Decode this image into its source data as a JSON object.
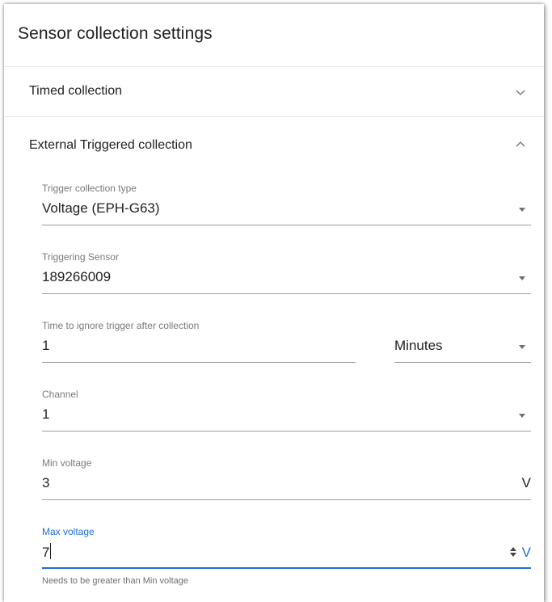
{
  "card": {
    "title": "Sensor collection settings"
  },
  "panels": {
    "timed": {
      "label": "Timed collection",
      "expanded": false
    },
    "external": {
      "label": "External Triggered collection",
      "expanded": true
    }
  },
  "fields": {
    "trigger_type": {
      "label": "Trigger collection type",
      "value": "Voltage (EPH-G63)"
    },
    "triggering_sensor": {
      "label": "Triggering Sensor",
      "value": "189266009"
    },
    "ignore_time": {
      "label": "Time to ignore trigger after collection",
      "value": "1",
      "unit": "Minutes"
    },
    "channel": {
      "label": "Channel",
      "value": "1"
    },
    "min_voltage": {
      "label": "Min voltage",
      "value": "3",
      "suffix": "V"
    },
    "max_voltage": {
      "label": "Max voltage",
      "value": "7",
      "suffix": "V",
      "hint": "Needs to be greater than Min voltage"
    }
  },
  "colors": {
    "accent": "#1e6fd9",
    "text": "#212121",
    "secondary_text": "#7a7a7a",
    "divider": "#e6e6e6"
  },
  "icons": {
    "collapsed": "chevron-down-icon",
    "expanded": "chevron-up-icon",
    "dropdown": "dropdown-arrow-icon",
    "spinner": "number-spinner-icon"
  }
}
